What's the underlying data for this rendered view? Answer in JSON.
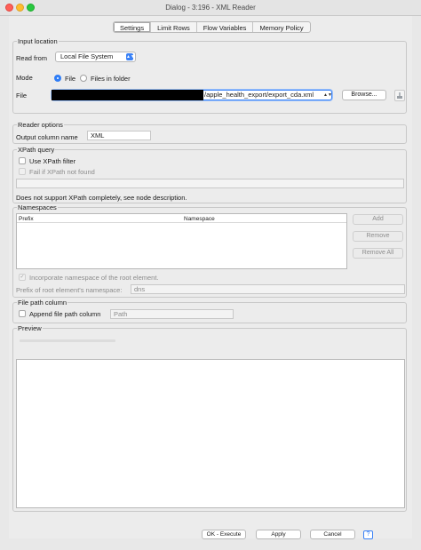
{
  "window": {
    "title": "Dialog - 3:196 - XML Reader"
  },
  "tabs": [
    {
      "label": "Settings",
      "active": true
    },
    {
      "label": "Limit Rows",
      "active": false
    },
    {
      "label": "Flow Variables",
      "active": false
    },
    {
      "label": "Memory Policy",
      "active": false
    }
  ],
  "input_location": {
    "title": "Input location",
    "read_from_label": "Read from",
    "read_from_value": "Local File System",
    "mode_label": "Mode",
    "mode_file": "File",
    "mode_files_in_folder": "Files in folder",
    "file_label": "File",
    "file_path_visible": "/apple_health_export/export_cda.xml",
    "browse_label": "Browse..."
  },
  "reader_options": {
    "title": "Reader options",
    "output_column_label": "Output column name",
    "output_column_value": "XML"
  },
  "xpath_query": {
    "title": "XPath query",
    "use_xpath_label": "Use XPath filter",
    "fail_label": "Fail if XPath not found",
    "note": "Does not support XPath completely, see node description."
  },
  "namespaces": {
    "title": "Namespaces",
    "col_prefix": "Prefix",
    "col_namespace": "Namespace",
    "add_label": "Add",
    "remove_label": "Remove",
    "remove_all_label": "Remove All",
    "incorporate_label": "Incorporate namespace of the root element.",
    "prefix_root_label": "Prefix of root element's namespace:",
    "prefix_root_value": "dns"
  },
  "file_path_column": {
    "title": "File path column",
    "append_label": "Append file path column",
    "path_value": "Path"
  },
  "preview": {
    "title": "Preview"
  },
  "footer": {
    "ok_label": "OK - Execute",
    "apply_label": "Apply",
    "cancel_label": "Cancel",
    "help_label": "?"
  },
  "colors": {
    "accent": "#2f7df6",
    "close": "#ff5f57",
    "minimize": "#febc2e",
    "maximize": "#28c840"
  }
}
